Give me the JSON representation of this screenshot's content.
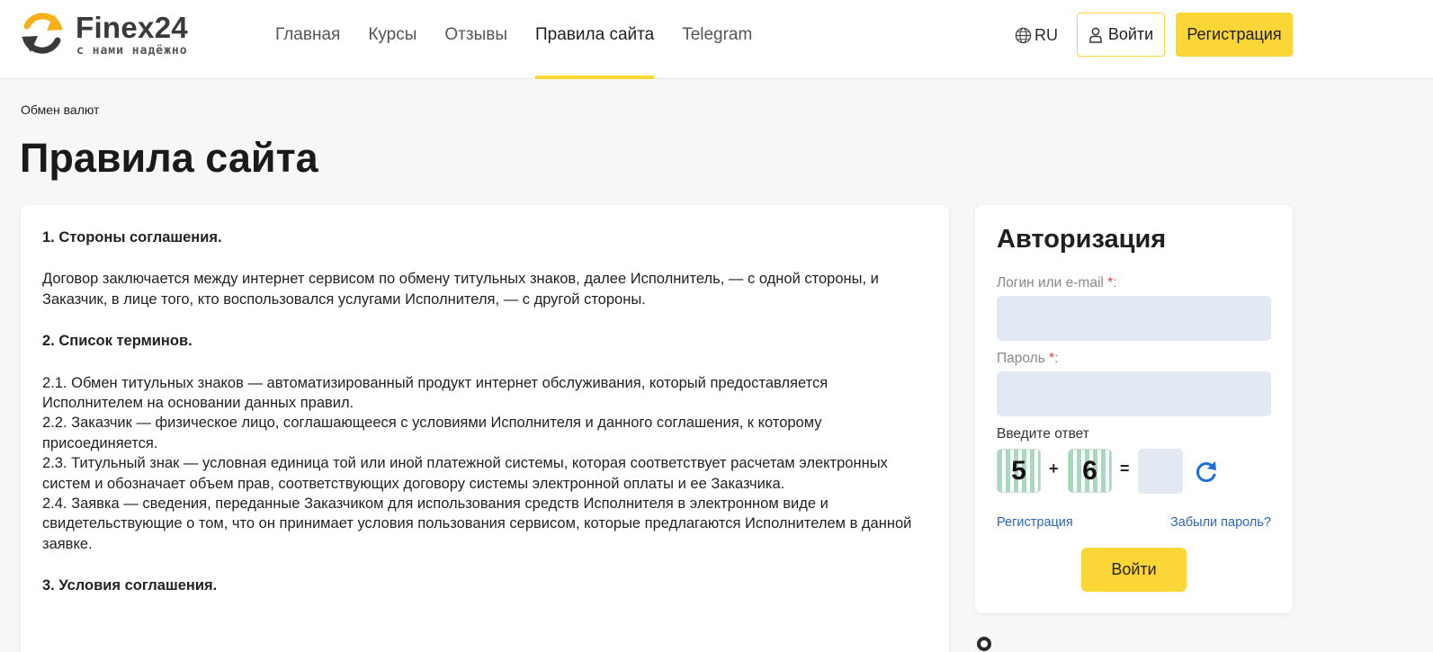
{
  "header": {
    "logo": {
      "name": "Finex24",
      "tagline": "с нами надёжно"
    },
    "nav": [
      {
        "label": "Главная",
        "active": false
      },
      {
        "label": "Курсы",
        "active": false
      },
      {
        "label": "Отзывы",
        "active": false
      },
      {
        "label": "Правила сайта",
        "active": true
      },
      {
        "label": "Telegram",
        "active": false
      }
    ],
    "lang": "RU",
    "login_label": "Войти",
    "register_label": "Регистрация"
  },
  "breadcrumb": "Обмен валют",
  "page_title": "Правила сайта",
  "content": {
    "s1_heading": "1. Стороны соглашения.",
    "s1_text": "Договор заключается между интернет сервисом по обмену титульных знаков, далее Исполнитель, — с одной стороны, и Заказчик, в лице того, кто воспользовался услугами Исполнителя, — с другой стороны.",
    "s2_heading": "2. Список терминов.",
    "terms": [
      "2.1. Обмен титульных знаков — автоматизированный продукт интернет обслуживания, который предоставляется Исполнителем на основании данных правил.",
      "2.2. Заказчик — физическое лицо, соглашающееся с условиями Исполнителя и данного соглашения, к которому присоединяется.",
      "2.3. Титульный знак — условная единица той или иной платежной системы, которая соответствует расчетам электронных систем и обозначает объем прав, соответствующих договору системы электронной оплаты и ее Заказчика.",
      "2.4. Заявка — сведения, переданные Заказчиком для использования средств Исполнителя в электронном виде и свидетельствующие о том, что он принимает условия пользования сервисом, которые предлагаются Исполнителем в данной заявке."
    ],
    "s3_heading": "3. Условия соглашения."
  },
  "auth": {
    "title": "Авторизация",
    "login_label": "Логин или e-mail",
    "login_value": "",
    "password_label": "Пароль",
    "password_value": "",
    "required_mark": "*",
    "label_suffix": ":",
    "captcha_label": "Введите ответ",
    "captcha": {
      "a": "5",
      "op": "+",
      "b": "6",
      "eq": "=",
      "answer": ""
    },
    "register_link": "Регистрация",
    "forgot_link": "Забыли пароль?",
    "submit_label": "Войти"
  },
  "colors": {
    "accent_yellow": "#fbd637",
    "link_blue": "#2a66b8",
    "input_bg": "#e3e9f2",
    "required_red": "#e53935",
    "logo_orange": "#f5b01a"
  }
}
